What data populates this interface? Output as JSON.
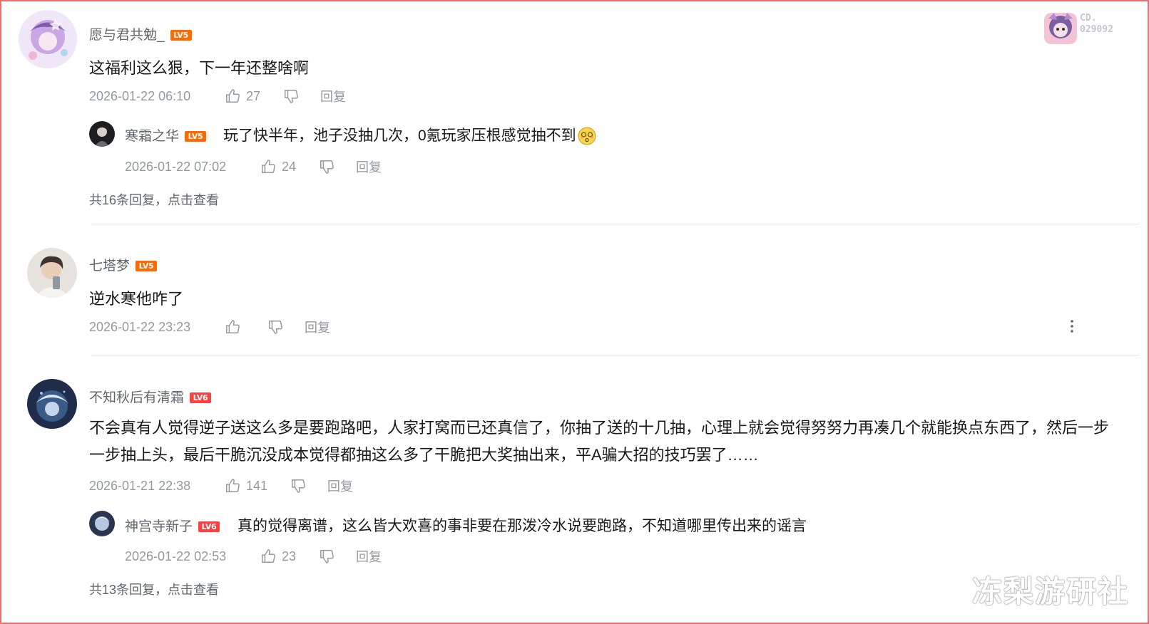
{
  "comments": [
    {
      "username": "愿与君共勉_",
      "level": "LV5",
      "content": "这福利这么狠，下一年还整啥啊",
      "time": "2026-01-22 06:10",
      "likes": "27",
      "reply_label": "回复",
      "replies": [
        {
          "username": "寒霜之华",
          "level": "LV5",
          "content": "玩了快半年，池子没抽几次，0氪玩家压根感觉抽不到",
          "time": "2026-01-22 07:02",
          "likes": "24",
          "reply_label": "回复"
        }
      ],
      "more_replies": "共16条回复，点击查看"
    },
    {
      "username": "七塔梦",
      "level": "LV5",
      "content": "逆水寒他咋了",
      "time": "2026-01-22 23:23",
      "likes": "",
      "reply_label": "回复"
    },
    {
      "username": "不知秋后有清霜",
      "level": "LV6",
      "content": "不会真有人觉得逆子送这么多是要跑路吧，人家打窝而已还真信了，你抽了送的十几抽，心理上就会觉得努努力再凑几个就能换点东西了，然后一步一步抽上头，最后干脆沉没成本觉得都抽这么多了干脆把大奖抽出来，平A骗大招的技巧罢了……",
      "time": "2026-01-21 22:38",
      "likes": "141",
      "reply_label": "回复",
      "replies": [
        {
          "username": "神宫寺新子",
          "level": "LV6",
          "content": "真的觉得离谱，这么皆大欢喜的事非要在那泼冷水说要跑路，不知道哪里传出来的谣言",
          "time": "2026-01-22 02:53",
          "likes": "23",
          "reply_label": "回复"
        }
      ],
      "more_replies": "共13条回复，点击查看"
    }
  ],
  "badge": {
    "line1": "CD.",
    "line2": "029092"
  },
  "watermark": "冻梨游研社",
  "colors": {
    "frame": "#e8706f",
    "level5": "#ff6a00",
    "level6": "#ff4040",
    "meta": "#9499a0"
  }
}
